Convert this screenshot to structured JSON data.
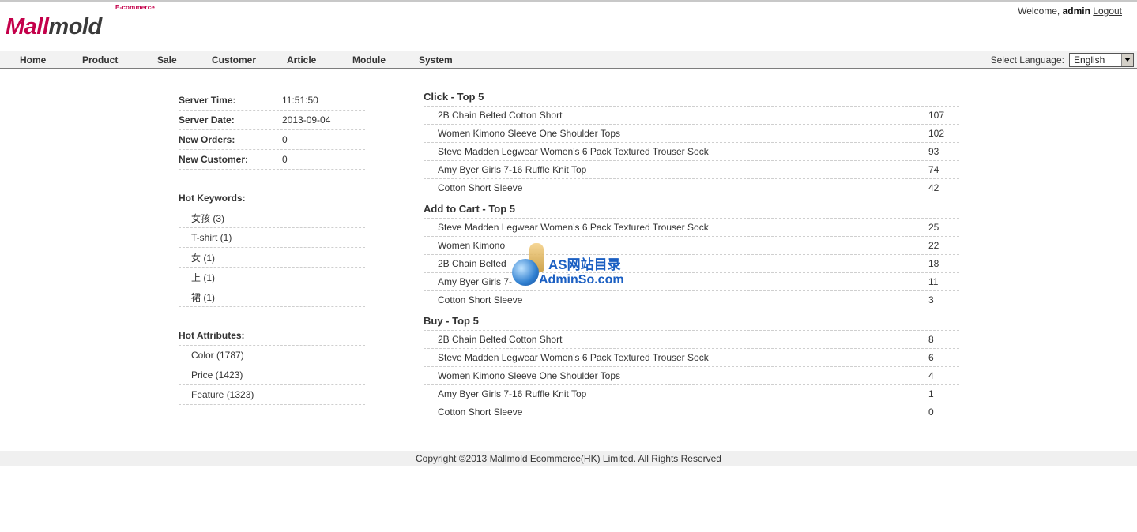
{
  "header": {
    "logo_tag": "E-commerce",
    "logo_part1": "Mall",
    "logo_part2": "mold",
    "welcome_prefix": "Welcome,",
    "user": "admin",
    "logout": "Logout"
  },
  "nav": {
    "items": [
      "Home",
      "Product",
      "Sale",
      "Customer",
      "Article",
      "Module",
      "System"
    ],
    "language_label": "Select Language:",
    "language_value": "English"
  },
  "stats": {
    "server_time_label": "Server Time:",
    "server_time": "11:51:50",
    "server_date_label": "Server Date:",
    "server_date": "2013-09-04",
    "new_orders_label": "New Orders:",
    "new_orders": "0",
    "new_customer_label": "New Customer:",
    "new_customer": "0"
  },
  "hot_keywords": {
    "title": "Hot Keywords:",
    "items": [
      "女孩 (3)",
      "T-shirt (1)",
      "女 (1)",
      "上 (1)",
      "裙 (1)"
    ]
  },
  "hot_attributes": {
    "title": "Hot Attributes:",
    "items": [
      "Color (1787)",
      "Price (1423)",
      "Feature (1323)"
    ]
  },
  "click_top": {
    "title": "Click - Top 5",
    "rows": [
      {
        "name": "2B Chain Belted Cotton Short",
        "value": "107"
      },
      {
        "name": "Women Kimono Sleeve One Shoulder Tops",
        "value": "102"
      },
      {
        "name": "Steve Madden Legwear Women's 6 Pack Textured Trouser Sock",
        "value": "93"
      },
      {
        "name": "Amy Byer Girls 7-16 Ruffle Knit Top",
        "value": "74"
      },
      {
        "name": "Cotton Short Sleeve",
        "value": "42"
      }
    ]
  },
  "cart_top": {
    "title": "Add to Cart - Top 5",
    "rows": [
      {
        "name": "Steve Madden Legwear Women's 6 Pack Textured Trouser Sock",
        "value": "25"
      },
      {
        "name": "Women Kimono",
        "value": "22"
      },
      {
        "name": "2B Chain Belted",
        "value": "18"
      },
      {
        "name": "Amy Byer Girls 7-",
        "value": "11"
      },
      {
        "name": "Cotton Short Sleeve",
        "value": "3"
      }
    ]
  },
  "buy_top": {
    "title": "Buy - Top 5",
    "rows": [
      {
        "name": "2B Chain Belted Cotton Short",
        "value": "8"
      },
      {
        "name": "Steve Madden Legwear Women's 6 Pack Textured Trouser Sock",
        "value": "6"
      },
      {
        "name": "Women Kimono Sleeve One Shoulder Tops",
        "value": "4"
      },
      {
        "name": "Amy Byer Girls 7-16 Ruffle Knit Top",
        "value": "1"
      },
      {
        "name": "Cotton Short Sleeve",
        "value": "0"
      }
    ]
  },
  "watermark": {
    "line1": "AS网站目录",
    "line2": "AdminSo.com"
  },
  "footer": {
    "copyright": "Copyright ©2013 Mallmold Ecommerce(HK) Limited. All Rights Reserved"
  }
}
